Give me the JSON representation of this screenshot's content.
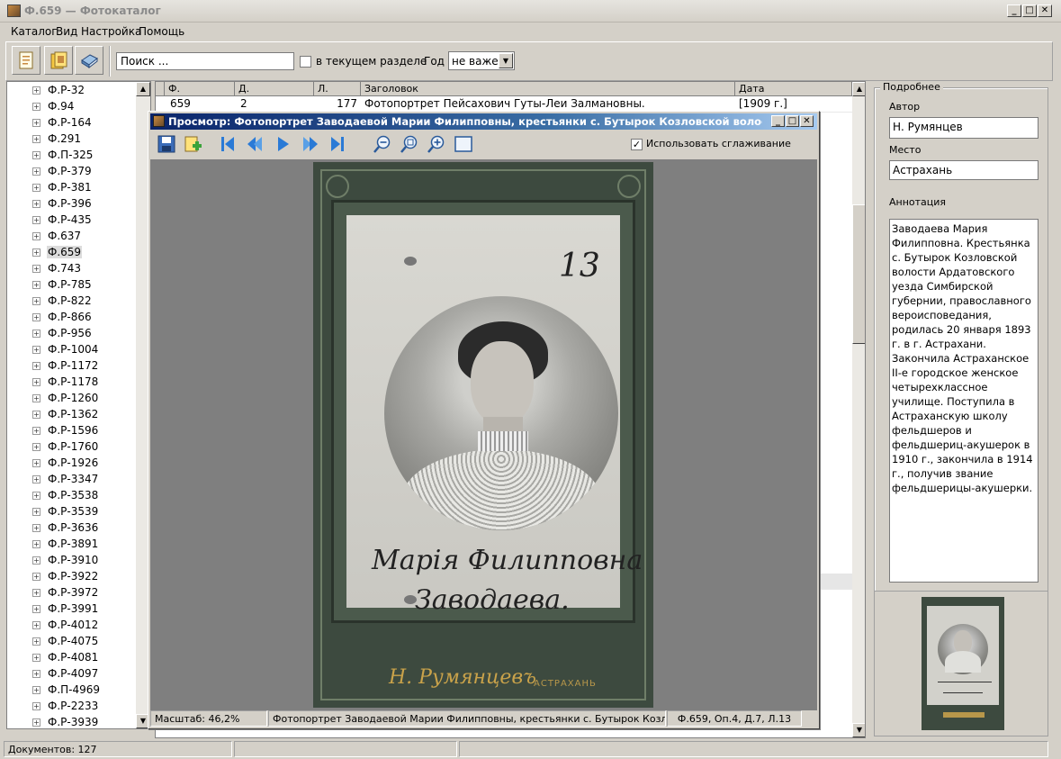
{
  "window": {
    "title": "Ф.659 — Фотокаталог",
    "min": "_",
    "max": "□",
    "close": "✕"
  },
  "menu": [
    "Каталог",
    "Вид",
    "Настройка",
    "Помощь"
  ],
  "toolbar": {
    "search_placeholder": "Поиск ...",
    "in_section_label": "в текущем разделе",
    "year_label": "Год",
    "year_value": "не важен"
  },
  "tree": {
    "items": [
      "Ф.Р-32",
      "Ф.94",
      "Ф.Р-164",
      "Ф.291",
      "Ф.П-325",
      "Ф.Р-379",
      "Ф.Р-381",
      "Ф.Р-396",
      "Ф.Р-435",
      "Ф.637",
      "Ф.659",
      "Ф.743",
      "Ф.Р-785",
      "Ф.Р-822",
      "Ф.Р-866",
      "Ф.Р-956",
      "Ф.Р-1004",
      "Ф.Р-1172",
      "Ф.Р-1178",
      "Ф.Р-1260",
      "Ф.Р-1362",
      "Ф.Р-1596",
      "Ф.Р-1760",
      "Ф.Р-1926",
      "Ф.Р-3347",
      "Ф.Р-3538",
      "Ф.Р-3539",
      "Ф.Р-3636",
      "Ф.Р-3891",
      "Ф.Р-3910",
      "Ф.Р-3922",
      "Ф.Р-3972",
      "Ф.Р-3991",
      "Ф.Р-4012",
      "Ф.Р-4075",
      "Ф.Р-4081",
      "Ф.Р-4097",
      "Ф.П-4969",
      "Ф.Р-2233",
      "Ф.Р-3939"
    ],
    "selected": "Ф.659"
  },
  "table": {
    "columns": [
      "Ф.",
      "Д.",
      "Л.",
      "Заголовок",
      "Дата"
    ],
    "rows": [
      [
        "659",
        "2",
        "177",
        "Фотопортрет Пейсахович Гуты-Леи Залмановны.",
        "[1909 г.]"
      ]
    ]
  },
  "details": {
    "group_title": "Подробнее",
    "author_label": "Автор",
    "author_value": "Н. Румянцев",
    "place_label": "Место",
    "place_value": "Астрахань",
    "annotation_label": "Аннотация",
    "annotation_text": "Заводаева Мария\nФилипповна. Крестьянка\nс. Бутырок Козловской\nволости Ардатовского\nуезда Симбирской\nгубернии, православного\nвероисповедания,\nродилась 20 января 1893\nг. в г. Астрахани.\nЗакончила Астраханское\nII-е городское женское\nчетырехклассное\nучилище. Поступила в\nАстраханскую школу\nфельдшеров и\nфельдшериц-акушерок в\n1910 г., закончила в 1914\nг., получив звание\nфельдшерицы-акушерки."
  },
  "status": {
    "documents": "Документов: 127"
  },
  "preview": {
    "title": "Просмотр: Фотопортрет Заводаевой Марии Филипповны, крестьянки с. Бутырок Козловской волости Ардатовс...",
    "smoothing_label": "Использовать сглаживание",
    "zoom": "Масштаб: 46,2%",
    "caption": "Фотопортрет Заводаевой Марии Филипповны, крестьянки с. Бутырок Козловской во.",
    "reference": "Ф.659, Оп.4, Д.7, Л.13",
    "photo": {
      "number": "13",
      "inscription_line1": "Марія Филипповна",
      "inscription_line2": "Заводаева.",
      "studio": "Н. Румянцевъ",
      "city": "АСТРАХАНЬ"
    }
  }
}
